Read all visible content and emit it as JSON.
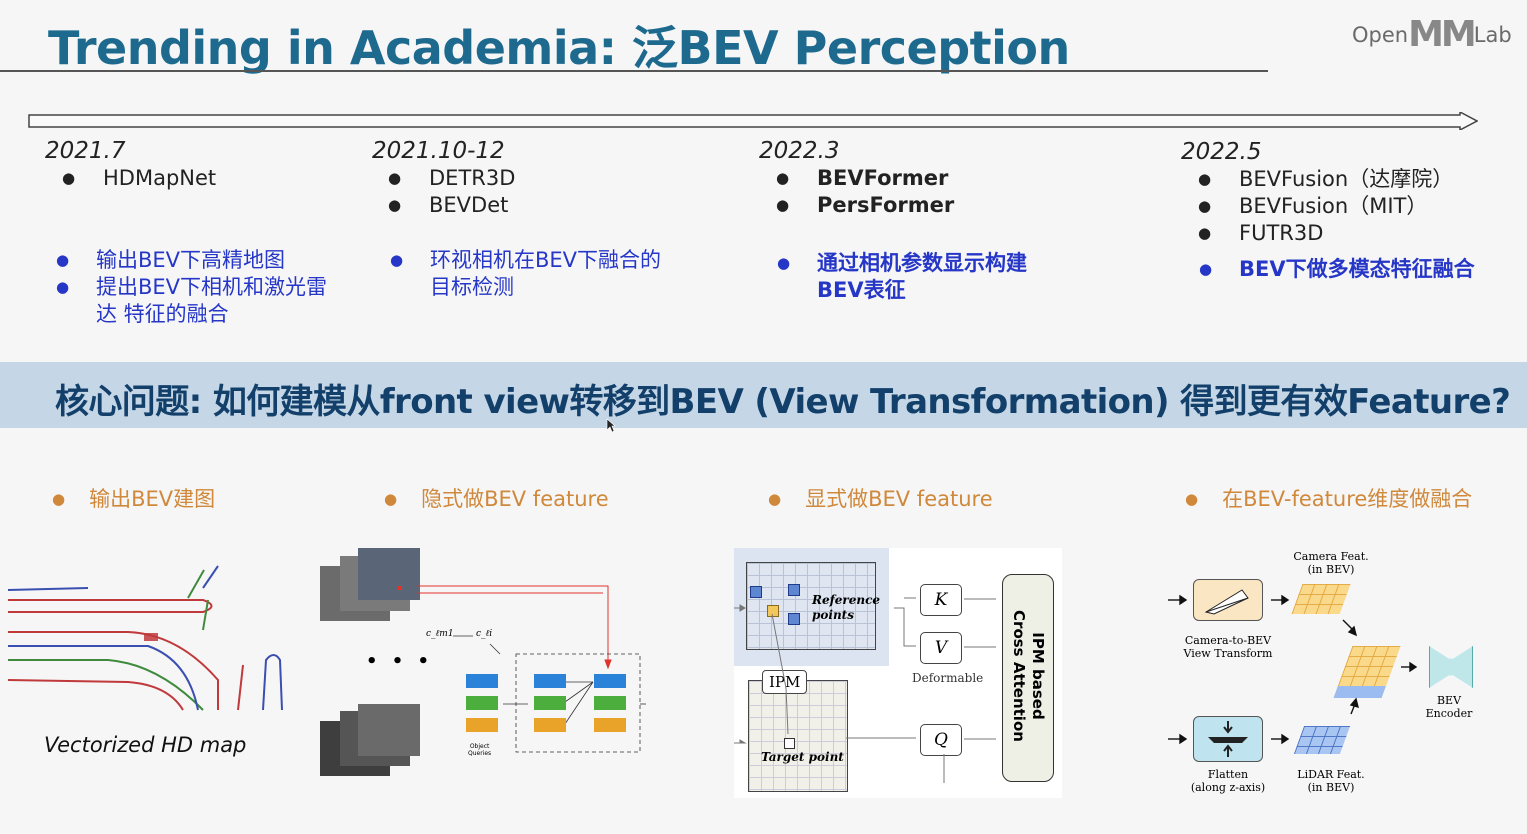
{
  "slide": {
    "title": "Trending in Academia:   泛BEV Perception",
    "logo": {
      "pre": "Open",
      "mid": "MM",
      "post": "Lab"
    }
  },
  "timeline": [
    {
      "date": "2021.7",
      "models": [
        "HDMapNet"
      ],
      "notes": [
        "输出BEV下高精地图",
        "提出BEV下相机和激光雷达 特征的融合"
      ]
    },
    {
      "date": "2021.10-12",
      "models": [
        "DETR3D",
        "BEVDet"
      ],
      "notes": [
        "环视相机在BEV下融合的目标检测"
      ]
    },
    {
      "date": "2022.3",
      "models": [
        "BEVFormer",
        "PersFormer"
      ],
      "notes": [
        "通过相机参数显示构建BEV表征"
      ]
    },
    {
      "date": "2022.5",
      "models": [
        "BEVFusion（达摩院）",
        "BEVFusion（MIT）",
        "FUTR3D"
      ],
      "notes": [
        "BEV下做多模态特征融合"
      ]
    }
  ],
  "core_question": "核心问题: 如何建模从front view转移到BEV (View Transformation) 得到更有效Feature?",
  "categories": [
    "输出BEV建图",
    "隐式做BEV feature",
    "显式做BEV feature",
    "在BEV-feature维度做融合"
  ],
  "figures": {
    "hdmap": {
      "caption": "Vectorized HD map"
    },
    "detr3d": {
      "label_ctm": "c_ℓm1",
      "label_cli": "c_ℓi",
      "object_queries": "Object\nQueries",
      "dots": "• • •"
    },
    "bevformer": {
      "reference_points": "Reference\npoints",
      "ipm": "IPM",
      "target_point": "Target point",
      "k": "K",
      "v": "V",
      "q": "Q",
      "deformable": "Deformable",
      "cross_attention": "IPM based\nCross Attention"
    },
    "bevfusion": {
      "camera_feat": "Camera Feat.\n(in BEV)",
      "cam_to_bev": "Camera-to-BEV\nView Transform",
      "bev_encoder": "BEV\nEncoder",
      "flatten": "Flatten\n(along z-axis)",
      "lidar_feat": "LiDAR Feat.\n(in BEV)"
    }
  },
  "colors": {
    "title": "#1e6a8e",
    "blue_note": "#2637c7",
    "orange": "#d0883a",
    "banner": "#c5d6e6"
  }
}
